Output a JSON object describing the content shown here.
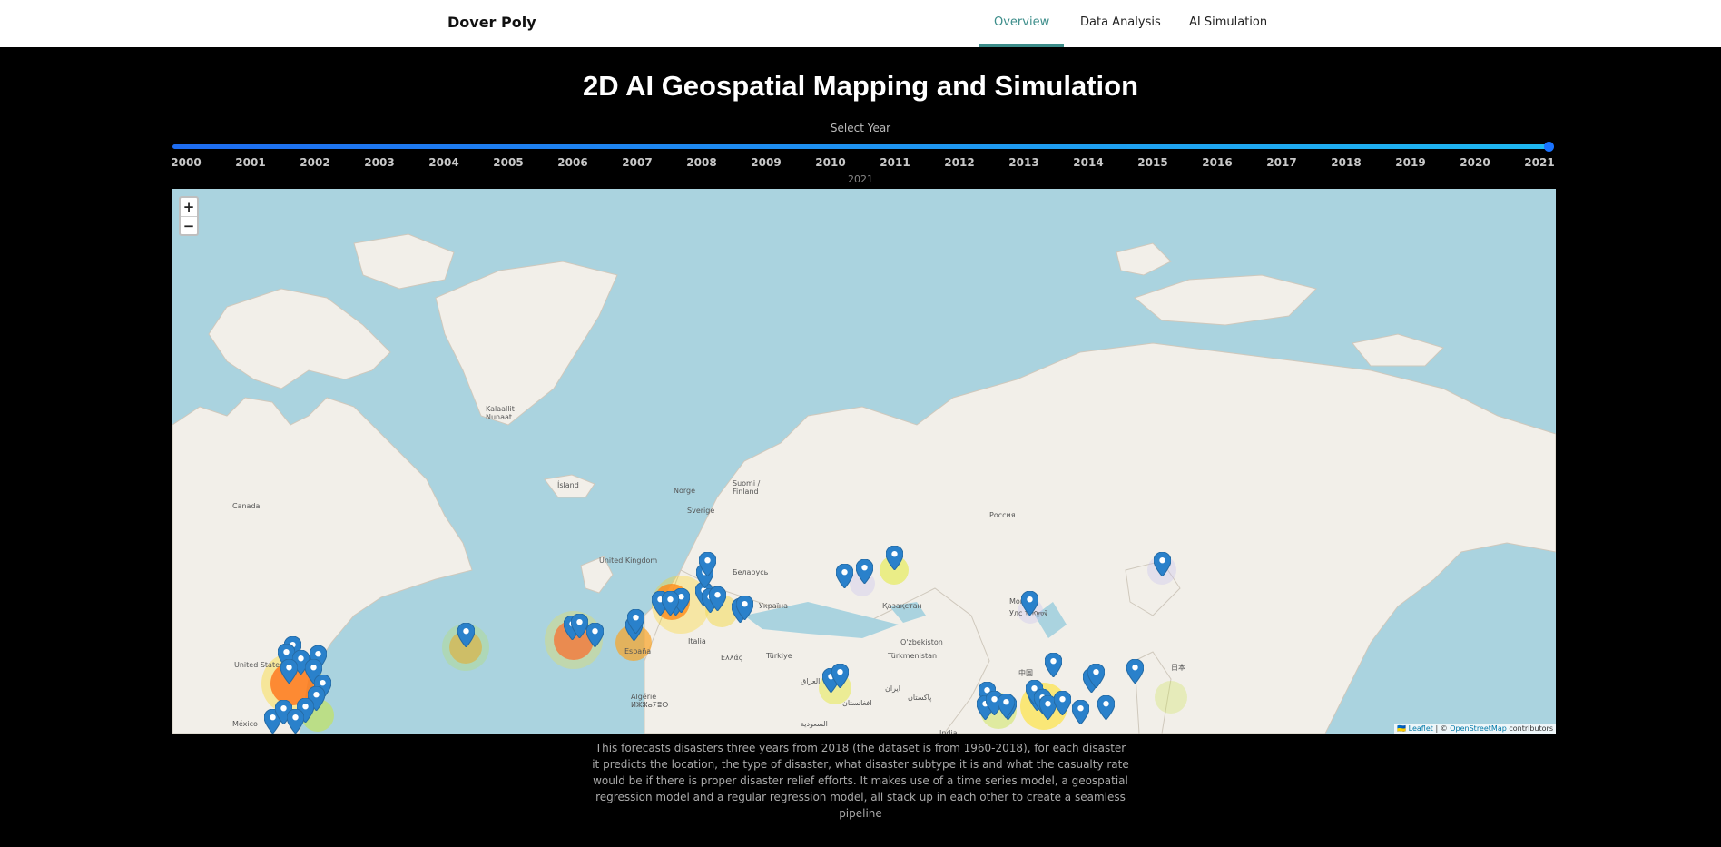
{
  "navbar": {
    "brand": "Dover Poly",
    "links": [
      {
        "label": "Overview",
        "active": true
      },
      {
        "label": "Data Analysis",
        "active": false
      },
      {
        "label": "AI Simulation",
        "active": false
      }
    ]
  },
  "title": "2D AI Geospatial Mapping and Simulation",
  "year_slider": {
    "label": "Select Year",
    "ticks": [
      "2000",
      "2001",
      "2002",
      "2003",
      "2004",
      "2005",
      "2006",
      "2007",
      "2008",
      "2009",
      "2010",
      "2011",
      "2012",
      "2013",
      "2014",
      "2015",
      "2016",
      "2017",
      "2018",
      "2019",
      "2020",
      "2021"
    ],
    "selected": "2021",
    "min": 2000,
    "max": 2021
  },
  "map": {
    "zoom_in": "+",
    "zoom_out": "−",
    "place_labels": [
      {
        "name": "Kalaallit",
        "line2": "Nunaat"
      },
      {
        "name": "Ísland"
      },
      {
        "name": "Canada"
      },
      {
        "name": "Norge"
      },
      {
        "name": "Suomi /",
        "line2": "Finland"
      },
      {
        "name": "Sverige"
      },
      {
        "name": "Россия"
      },
      {
        "name": "United Kingdom"
      },
      {
        "name": "Беларусь"
      },
      {
        "name": "Україна"
      },
      {
        "name": "Қазақстан"
      },
      {
        "name": "Монгол",
        "line2": "Улс ᠮᠣᠩᠭᠣᠯ"
      },
      {
        "name": "O'zbekiston"
      },
      {
        "name": "Türkmenistan"
      },
      {
        "name": "Türkiye"
      },
      {
        "name": "Ελλάς"
      },
      {
        "name": "Italia"
      },
      {
        "name": "España"
      },
      {
        "name": "United States"
      },
      {
        "name": "México"
      },
      {
        "name": "Algérie",
        "line2": "ⵍⵣⵣⴰⵢⴻⵔ"
      },
      {
        "name": "العراق"
      },
      {
        "name": "ایران"
      },
      {
        "name": "افغانستان"
      },
      {
        "name": "پاکستان"
      },
      {
        "name": "السعودية"
      },
      {
        "name": "India"
      },
      {
        "name": "中国"
      },
      {
        "name": "日本"
      }
    ],
    "marker_count": 52,
    "attribution": {
      "leaflet": "Leaflet",
      "separator": " | © ",
      "osm": "OpenStreetMap",
      "suffix": " contributors"
    }
  },
  "description": "This forecasts disasters three years from 2018 (the dataset is from 1960-2018), for each disaster it predicts the location, the type of disaster, what disaster subtype it is and what the casualty rate would be if there is proper disaster relief efforts. It makes use of a time series model, a geospatial regression model and a regular regression model, all stack up in each other to create a seamless pipeline",
  "colors": {
    "accent": "#3c8d8a",
    "slider": "#1a73ff",
    "marker": "#2a81cb",
    "water": "#aad3df",
    "land": "#f2efe9"
  }
}
